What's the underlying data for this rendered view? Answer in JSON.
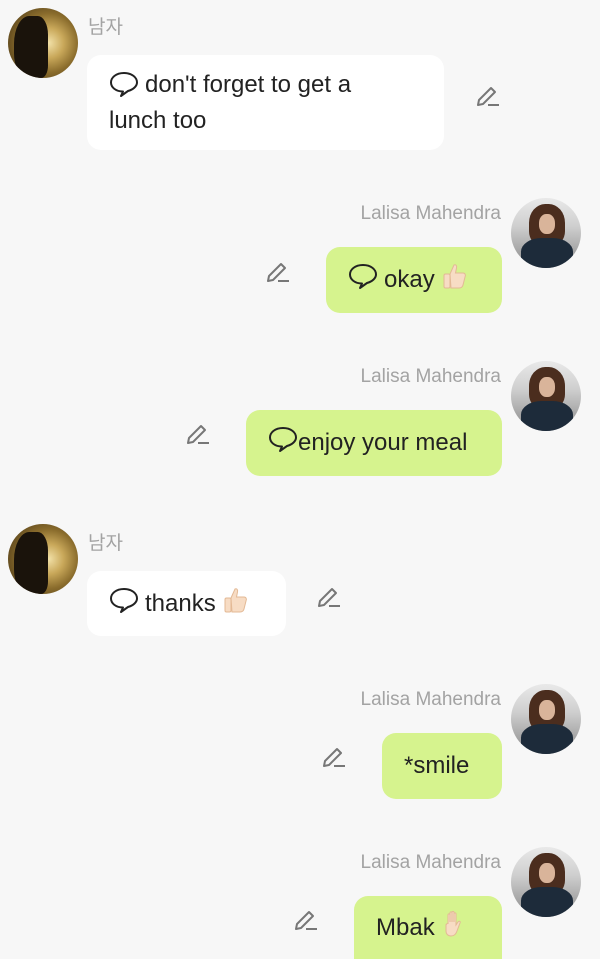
{
  "messages": [
    {
      "sender": "남자",
      "side": "left",
      "text": "don't forget to get a lunch too",
      "line1": "don't forget to get a",
      "line2": "lunch too",
      "has_chat_icon": true,
      "emoji": ""
    },
    {
      "sender": "Lalisa Mahendra",
      "side": "right",
      "text": "okay",
      "has_chat_icon": true,
      "emoji": "thumbs-up"
    },
    {
      "sender": "Lalisa Mahendra",
      "side": "right",
      "text": "enjoy your meal",
      "has_chat_icon": true,
      "emoji": ""
    },
    {
      "sender": "남자",
      "side": "left",
      "text": "thanks",
      "has_chat_icon": true,
      "emoji": "thumbs-up"
    },
    {
      "sender": "Lalisa Mahendra",
      "side": "right",
      "text": "*smile",
      "has_chat_icon": false,
      "emoji": ""
    },
    {
      "sender": "Lalisa Mahendra",
      "side": "right",
      "text": "Mbak",
      "has_chat_icon": false,
      "emoji": "raised-hand"
    }
  ],
  "colors": {
    "background": "#f7f7f7",
    "incoming_bubble": "#ffffff",
    "outgoing_bubble": "#d6f38e",
    "sender_name": "#a3a3a3",
    "text": "#222222"
  },
  "icons": {
    "edit": "pencil-edit-icon",
    "chat": "speech-bubble-icon",
    "thumbs_up": "thumbs-up-emoji",
    "raised_hand": "raised-hand-emoji"
  }
}
